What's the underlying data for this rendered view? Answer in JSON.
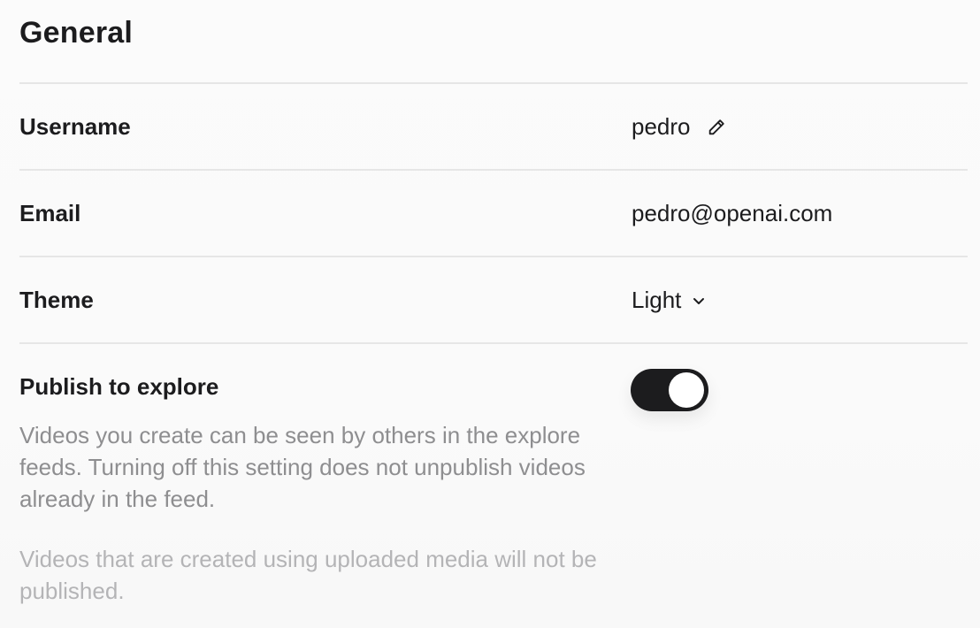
{
  "section": {
    "title": "General"
  },
  "username": {
    "label": "Username",
    "value": "pedro",
    "edit_icon": "pencil-icon"
  },
  "email": {
    "label": "Email",
    "value": "pedro@openai.com"
  },
  "theme": {
    "label": "Theme",
    "value": "Light",
    "dropdown_icon": "chevron-down-icon"
  },
  "publish": {
    "label": "Publish to explore",
    "enabled": true,
    "description": "Videos you create can be seen by others in the explore feeds. Turning off this setting does not unpublish videos already in the feed.",
    "note": "Videos that are created using uploaded media will not be published."
  },
  "colors": {
    "toggle_on": "#1c1c1e",
    "text_primary": "#1c1c1e",
    "text_secondary": "#8e8e90",
    "text_muted": "#b4b4b6",
    "divider": "#e6e6e6"
  }
}
